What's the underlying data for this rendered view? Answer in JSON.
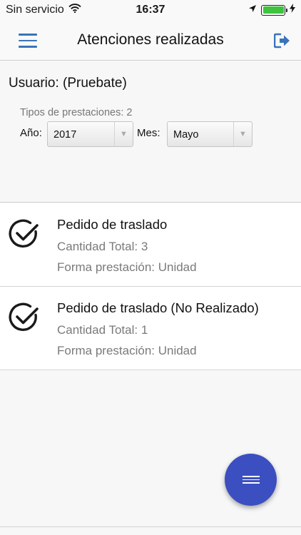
{
  "status_bar": {
    "carrier": "Sin servicio",
    "time": "16:37",
    "wifi_icon": "wifi-icon",
    "location_icon": "location-arrow-icon",
    "battery_icon": "battery-icon",
    "charging_icon": "charging-bolt-icon",
    "battery_level": 1.0
  },
  "nav": {
    "title": "Atenciones realizadas",
    "menu_icon": "hamburger-menu-icon",
    "logout_icon": "logout-icon"
  },
  "filters": {
    "user_label": "Usuario: (Pruebate)",
    "tipos_label": "Tipos de prestaciones: 2",
    "anio_label": "Año:",
    "anio_value": "2017",
    "mes_label": "Mes:",
    "mes_value": "Mayo"
  },
  "items": [
    {
      "title": "Pedido de traslado",
      "quantity": "Cantidad Total: 3",
      "form": "Forma prestación: Unidad",
      "icon": "check-circle-icon"
    },
    {
      "title": "Pedido de traslado (No Realizado)",
      "quantity": "Cantidad Total: 1",
      "form": "Forma prestación: Unidad",
      "icon": "check-circle-icon"
    }
  ],
  "fab": {
    "icon": "menu-lines-icon"
  },
  "colors": {
    "accent": "#3a74b8",
    "fab": "#3b4fc0",
    "battery": "#3ec43e"
  }
}
